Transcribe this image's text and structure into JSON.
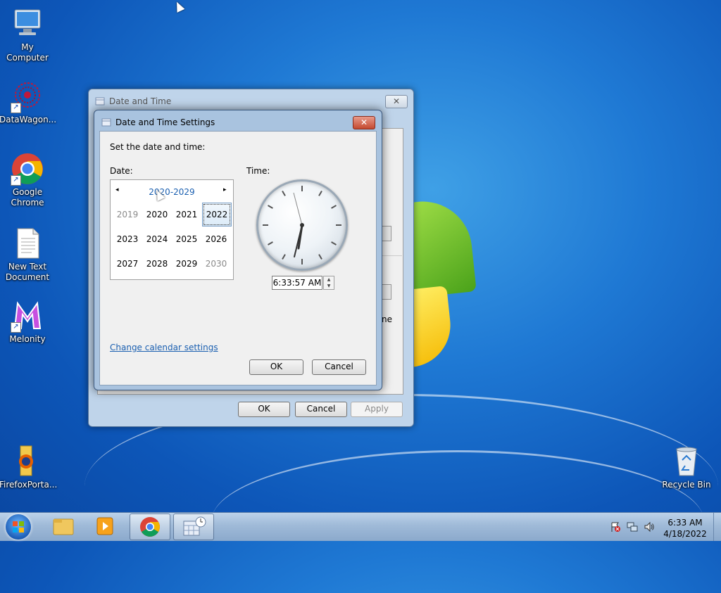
{
  "desktop": {
    "icons": [
      {
        "label": "My Computer"
      },
      {
        "label": "DataWagon..."
      },
      {
        "label": "Google Chrome"
      },
      {
        "label": "New Text Document"
      },
      {
        "label": "Melonity"
      },
      {
        "label": "FirefoxPorta..."
      },
      {
        "label": "Recycle Bin"
      }
    ]
  },
  "back_dialog": {
    "title": "Date and Time",
    "close_glyph": "✕",
    "partial_text": "ne",
    "ok_label": "OK",
    "cancel_label": "Cancel",
    "apply_label": "Apply"
  },
  "settings_dialog": {
    "title": "Date and Time Settings",
    "close_glyph": "✕",
    "instruction": "Set the date and time:",
    "date_label": "Date:",
    "time_label": "Time:",
    "calendar": {
      "header": "2020-2029",
      "prev_glyph": "◂",
      "next_glyph": "▸",
      "years": [
        {
          "label": "2019",
          "state": "dim"
        },
        {
          "label": "2020",
          "state": "normal"
        },
        {
          "label": "2021",
          "state": "normal"
        },
        {
          "label": "2022",
          "state": "selected"
        },
        {
          "label": "2023",
          "state": "normal"
        },
        {
          "label": "2024",
          "state": "normal"
        },
        {
          "label": "2025",
          "state": "normal"
        },
        {
          "label": "2026",
          "state": "normal"
        },
        {
          "label": "2027",
          "state": "normal"
        },
        {
          "label": "2028",
          "state": "normal"
        },
        {
          "label": "2029",
          "state": "normal"
        },
        {
          "label": "2030",
          "state": "dim"
        }
      ]
    },
    "time_value": "6:33:57 AM",
    "change_calendar_link": "Change calendar settings",
    "ok_label": "OK",
    "cancel_label": "Cancel"
  },
  "taskbar": {
    "clock_time": "6:33 AM",
    "clock_date": "4/18/2022"
  }
}
